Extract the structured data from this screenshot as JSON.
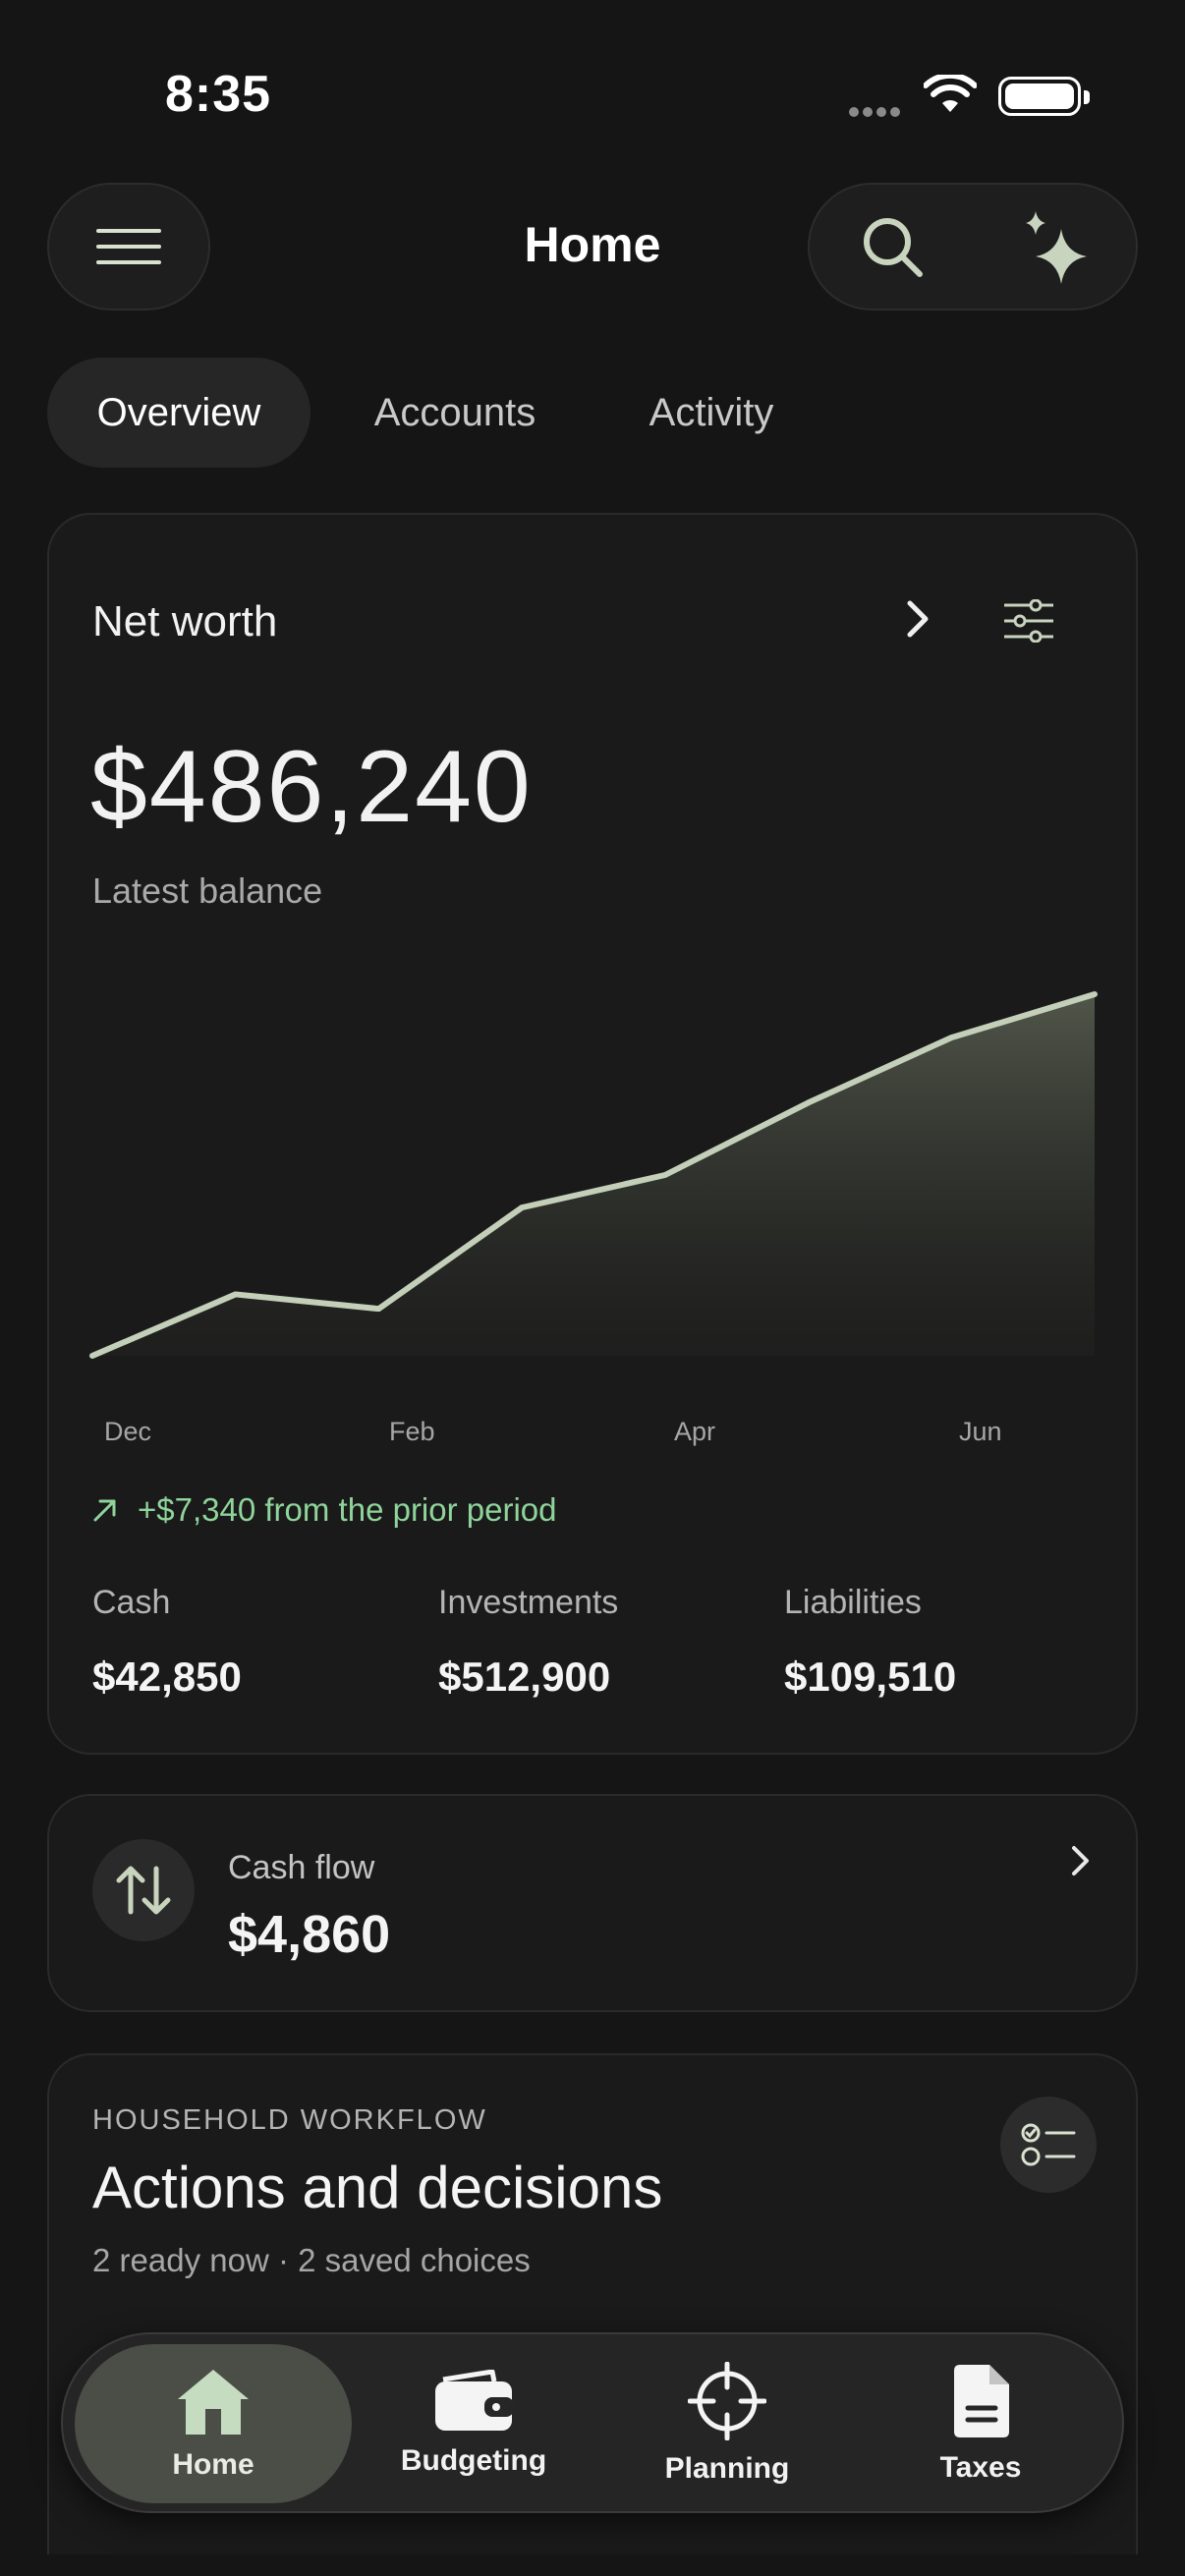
{
  "status_bar": {
    "time": "8:35"
  },
  "header": {
    "title": "Home"
  },
  "tabs": [
    {
      "label": "Overview",
      "active": true
    },
    {
      "label": "Accounts",
      "active": false
    },
    {
      "label": "Activity",
      "active": false
    }
  ],
  "net_worth": {
    "title": "Net worth",
    "amount": "$486,240",
    "subtitle": "Latest balance",
    "change_text": "+$7,340 from the prior period",
    "stats": [
      {
        "label": "Cash",
        "value": "$42,850"
      },
      {
        "label": "Investments",
        "value": "$512,900"
      },
      {
        "label": "Liabilities",
        "value": "$109,510"
      }
    ]
  },
  "chart_data": {
    "type": "area",
    "title": "",
    "xlabel": "",
    "ylabel": "",
    "x_tick_labels": [
      "Dec",
      "Feb",
      "Apr",
      "Jun"
    ],
    "x": [
      "Dec",
      "",
      "Feb",
      "",
      "Apr",
      "",
      "Jun",
      ""
    ],
    "values": [
      0,
      0.17,
      0.13,
      0.41,
      0.5,
      0.7,
      0.88,
      1.0
    ],
    "values_note_units": "relative",
    "grid": false,
    "line_color": "#c3cfb9",
    "fill_color": "#5a6052"
  },
  "cash_flow": {
    "label": "Cash flow",
    "value": "$4,860"
  },
  "workflow": {
    "eyebrow": "HOUSEHOLD WORKFLOW",
    "title": "Actions and decisions",
    "subtitle": "2 ready now · 2 saved choices"
  },
  "tabbar": {
    "items": [
      {
        "label": "Home",
        "icon": "home-icon",
        "active": true
      },
      {
        "label": "Budgeting",
        "icon": "wallet-icon",
        "active": false
      },
      {
        "label": "Planning",
        "icon": "crosshair-icon",
        "active": false
      },
      {
        "label": "Taxes",
        "icon": "document-icon",
        "active": false
      }
    ]
  },
  "colors": {
    "background": "#151515",
    "card": "#1a1a1a",
    "accent_green": "#8fd49b",
    "chart_line": "#c3cfb9",
    "tabbar_active": "#4a4e46",
    "home_icon": "#c6dcc0"
  }
}
